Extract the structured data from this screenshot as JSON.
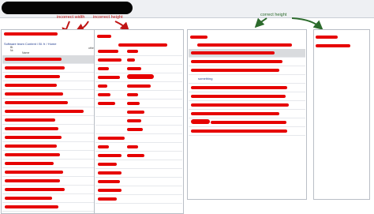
{
  "annotations": {
    "incorrect_width": "incorrect width",
    "incorrect_height": "incorrect height",
    "correct_height": "correct height",
    "colors": {
      "incorrect": "#c01515",
      "correct": "#2c6b2c"
    }
  },
  "left_panel": {
    "breadcrumb": "Software team Content / Bl. fr / Home",
    "header": {
      "col_a_1": "Bl.",
      "col_a_2": "Nr.",
      "col_b": "Name",
      "col_c": "other"
    }
  },
  "right_panel": {
    "link_text": "something"
  },
  "icons": [
    "window-title-redaction",
    "redaction-mark"
  ]
}
